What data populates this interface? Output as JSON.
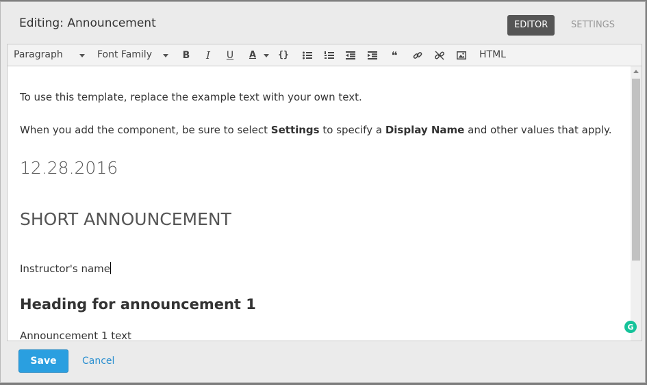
{
  "dialog": {
    "title": "Editing: Announcement",
    "tabs": [
      {
        "label": "EDITOR",
        "active": true
      },
      {
        "label": "SETTINGS",
        "active": false
      }
    ]
  },
  "toolbar": {
    "paragraph_select": "Paragraph",
    "font_family_select": "Font Family",
    "html_label": "HTML",
    "icons": [
      "bold-icon",
      "italic-icon",
      "underline-icon",
      "text-color-icon",
      "code-icon",
      "bullet-list-icon",
      "numbered-list-icon",
      "outdent-icon",
      "indent-icon",
      "blockquote-icon",
      "link-icon",
      "unlink-icon",
      "image-icon"
    ],
    "bold_glyph": "B",
    "italic_glyph": "I",
    "underline_glyph": "U",
    "text_color_glyph": "A",
    "code_glyph": "{}",
    "quote_glyph": "❝"
  },
  "content": {
    "intro": "To use this template, replace the example text with your own text.",
    "para2_a": "When you add the component, be sure to select ",
    "para2_settings": "Settings",
    "para2_b": " to specify a ",
    "para2_display_name": "Display Name",
    "para2_c": " and other values that apply.",
    "date": "12.28.2016",
    "short_title": "SHORT ANNOUNCEMENT",
    "instructor": "Instructor's name",
    "heading1": "Heading for announcement 1",
    "announcement_text": "Announcement 1 text"
  },
  "footer": {
    "save_label": "Save",
    "cancel_label": "Cancel"
  },
  "colors": {
    "accent": "#2a9fe0",
    "active_tab": "#555555",
    "grammarly": "#15c39a"
  },
  "grammarly_glyph": "G"
}
